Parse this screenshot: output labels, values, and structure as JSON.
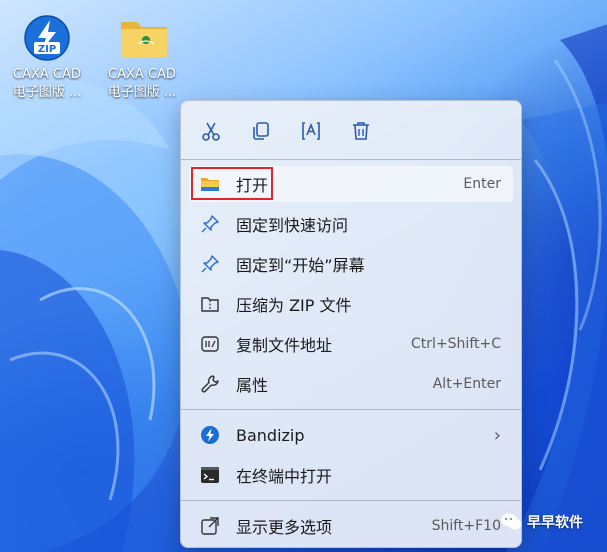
{
  "desktop_icons": [
    {
      "label_line1": "CAXA CAD",
      "label_line2": "电子图版 ...",
      "badge": "ZIP",
      "icon": "zip-archive-icon"
    },
    {
      "label_line1": "CAXA CAD",
      "label_line2": "电子图版 ...",
      "icon": "folder-icon"
    }
  ],
  "context_menu": {
    "quick_actions": [
      {
        "name": "cut",
        "icon": "scissors-icon"
      },
      {
        "name": "copy",
        "icon": "copy-icon"
      },
      {
        "name": "rename",
        "icon": "rename-icon"
      },
      {
        "name": "delete",
        "icon": "trash-icon"
      }
    ],
    "items": [
      {
        "label": "打开",
        "shortcut": "Enter",
        "icon": "folder-icon",
        "highlighted": true
      },
      {
        "label": "固定到快速访问",
        "shortcut": "",
        "icon": "pin-icon"
      },
      {
        "label": "固定到“开始”屏幕",
        "shortcut": "",
        "icon": "pin-icon"
      },
      {
        "label": "压缩为 ZIP 文件",
        "shortcut": "",
        "icon": "zip-folder-icon"
      },
      {
        "label": "复制文件地址",
        "shortcut": "Ctrl+Shift+C",
        "icon": "copy-path-icon"
      },
      {
        "label": "属性",
        "shortcut": "Alt+Enter",
        "icon": "wrench-icon"
      },
      {
        "label": "Bandizip",
        "shortcut": "",
        "icon": "bandizip-icon",
        "submenu_arrow": "›"
      },
      {
        "label": "在终端中打开",
        "shortcut": "",
        "icon": "terminal-icon"
      },
      {
        "label": "显示更多选项",
        "shortcut": "Shift+F10",
        "icon": "external-icon"
      }
    ]
  },
  "watermark": {
    "text": "早早软件"
  },
  "colors": {
    "accent": "#1a6fd6",
    "highlight_box": "#e0262d",
    "menu_bg": "#ecf0f8"
  }
}
